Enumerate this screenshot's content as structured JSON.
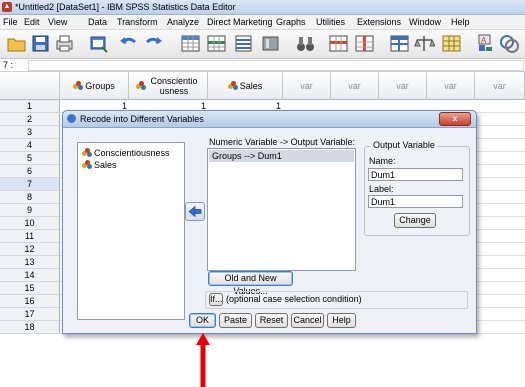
{
  "window": {
    "title": "*Untitled2 [DataSet1] - IBM SPSS Statistics Data Editor"
  },
  "menu": [
    "File",
    "Edit",
    "View",
    "Data",
    "Transform",
    "Analyze",
    "Direct Marketing",
    "Graphs",
    "Utilities",
    "Extensions",
    "Window",
    "Help"
  ],
  "toolbar_icons": [
    "open-file-icon",
    "save-icon",
    "print-icon",
    "recall-dialog-icon",
    "undo-icon",
    "redo-icon",
    "go-to-case-icon",
    "go-to-variable-icon",
    "variables-icon",
    "find-icon",
    "insert-cases-icon",
    "insert-variable-icon",
    "split-file-icon",
    "weight-cases-icon",
    "select-cases-icon",
    "value-labels-icon",
    "use-sets-icon"
  ],
  "cell_ref": "7 :",
  "grid": {
    "columns": [
      {
        "label": "Groups",
        "icon": "nominal-variable-icon"
      },
      {
        "label": "Conscientiousness",
        "icon": "nominal-variable-icon"
      },
      {
        "label": "Sales",
        "icon": "nominal-variable-icon"
      },
      {
        "label": "var"
      },
      {
        "label": "var"
      },
      {
        "label": "var"
      },
      {
        "label": "var"
      },
      {
        "label": "var"
      }
    ],
    "rows": [
      "1",
      "2",
      "3",
      "4",
      "5",
      "6",
      "7",
      "8",
      "9",
      "10",
      "11",
      "12",
      "13",
      "14",
      "15",
      "16",
      "17",
      "18"
    ],
    "row1": {
      "groups": "1",
      "conscientiousness": "1",
      "sales": "1"
    }
  },
  "dialog": {
    "title": "Recode into Different Variables",
    "close_label": "x",
    "source_vars": [
      "Conscientiousness",
      "Sales"
    ],
    "mapping_label": "Numeric Variable -> Output Variable:",
    "mapping_items": [
      "Groups --> Dum1"
    ],
    "output_group_label": "Output Variable",
    "name_label": "Name:",
    "name_value": "Dum1",
    "label_label": "Label:",
    "label_value": "Dum1",
    "change_label": "Change",
    "old_new_label": "Old and New Values...",
    "if_label": "If...",
    "if_hint": "(optional case selection condition)",
    "buttons": {
      "ok": "OK",
      "paste": "Paste",
      "reset": "Reset",
      "cancel": "Cancel",
      "help": "Help"
    }
  },
  "colors": {
    "pointer_arrow": "#e60000",
    "title_bar": "#c9d9ee"
  }
}
